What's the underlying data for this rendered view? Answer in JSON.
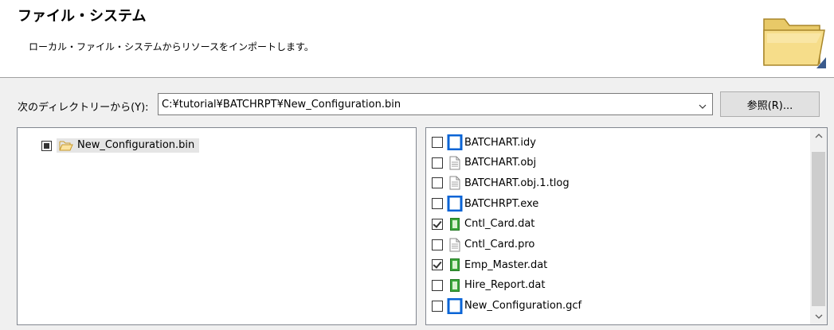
{
  "banner": {
    "title": "ファイル・システム",
    "description": "ローカル・ファイル・システムからリソースをインポートします。",
    "icon": "folder-icon"
  },
  "directory": {
    "label": "次のディレクトリーから(Y):",
    "value": "C:¥tutorial¥BATCHRPT¥New_Configuration.bin",
    "browse_label": "参照(R)..."
  },
  "tree": {
    "root_label": "New_Configuration.bin",
    "root_state": "partial"
  },
  "files": [
    {
      "name": "BATCHART.idy",
      "checked": false,
      "icon": "blue-square-icon"
    },
    {
      "name": "BATCHART.obj",
      "checked": false,
      "icon": "text-file-icon"
    },
    {
      "name": "BATCHART.obj.1.tlog",
      "checked": false,
      "icon": "text-file-icon"
    },
    {
      "name": "BATCHRPT.exe",
      "checked": false,
      "icon": "blue-square-icon"
    },
    {
      "name": "Cntl_Card.dat",
      "checked": true,
      "icon": "green-data-file-icon"
    },
    {
      "name": "Cntl_Card.pro",
      "checked": false,
      "icon": "text-file-icon"
    },
    {
      "name": "Emp_Master.dat",
      "checked": true,
      "icon": "green-data-file-icon"
    },
    {
      "name": "Hire_Report.dat",
      "checked": false,
      "icon": "green-data-file-icon"
    },
    {
      "name": "New_Configuration.gcf",
      "checked": false,
      "icon": "blue-square-icon"
    }
  ],
  "colors": {
    "banner_bg": "#ffffff",
    "dialog_bg": "#f0f0f0",
    "blue_icon": "#0a64d6",
    "green_icon": "#3aa63a",
    "selection_bg": "#e5e5e5"
  }
}
